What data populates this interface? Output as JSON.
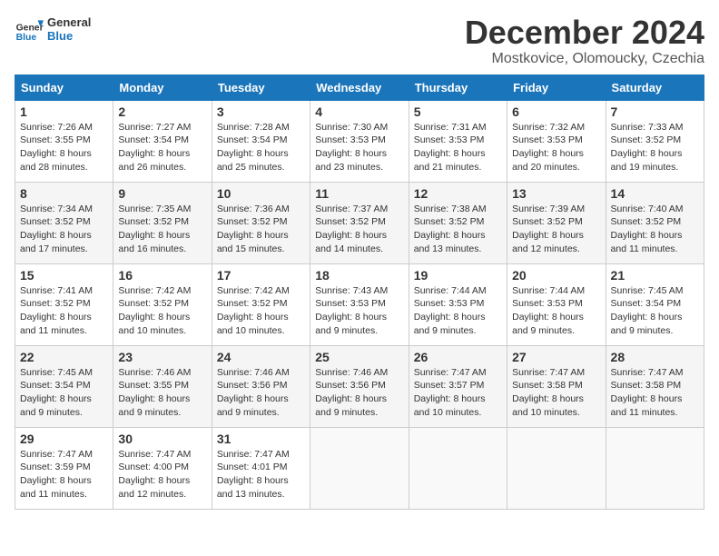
{
  "header": {
    "logo_text_general": "General",
    "logo_text_blue": "Blue",
    "month_title": "December 2024",
    "subtitle": "Mostkovice, Olomoucky, Czechia"
  },
  "days_of_week": [
    "Sunday",
    "Monday",
    "Tuesday",
    "Wednesday",
    "Thursday",
    "Friday",
    "Saturday"
  ],
  "weeks": [
    [
      {
        "day": "1",
        "sunrise": "7:26 AM",
        "sunset": "3:55 PM",
        "daylight": "8 hours and 28 minutes."
      },
      {
        "day": "2",
        "sunrise": "7:27 AM",
        "sunset": "3:54 PM",
        "daylight": "8 hours and 26 minutes."
      },
      {
        "day": "3",
        "sunrise": "7:28 AM",
        "sunset": "3:54 PM",
        "daylight": "8 hours and 25 minutes."
      },
      {
        "day": "4",
        "sunrise": "7:30 AM",
        "sunset": "3:53 PM",
        "daylight": "8 hours and 23 minutes."
      },
      {
        "day": "5",
        "sunrise": "7:31 AM",
        "sunset": "3:53 PM",
        "daylight": "8 hours and 21 minutes."
      },
      {
        "day": "6",
        "sunrise": "7:32 AM",
        "sunset": "3:53 PM",
        "daylight": "8 hours and 20 minutes."
      },
      {
        "day": "7",
        "sunrise": "7:33 AM",
        "sunset": "3:52 PM",
        "daylight": "8 hours and 19 minutes."
      }
    ],
    [
      {
        "day": "8",
        "sunrise": "7:34 AM",
        "sunset": "3:52 PM",
        "daylight": "8 hours and 17 minutes."
      },
      {
        "day": "9",
        "sunrise": "7:35 AM",
        "sunset": "3:52 PM",
        "daylight": "8 hours and 16 minutes."
      },
      {
        "day": "10",
        "sunrise": "7:36 AM",
        "sunset": "3:52 PM",
        "daylight": "8 hours and 15 minutes."
      },
      {
        "day": "11",
        "sunrise": "7:37 AM",
        "sunset": "3:52 PM",
        "daylight": "8 hours and 14 minutes."
      },
      {
        "day": "12",
        "sunrise": "7:38 AM",
        "sunset": "3:52 PM",
        "daylight": "8 hours and 13 minutes."
      },
      {
        "day": "13",
        "sunrise": "7:39 AM",
        "sunset": "3:52 PM",
        "daylight": "8 hours and 12 minutes."
      },
      {
        "day": "14",
        "sunrise": "7:40 AM",
        "sunset": "3:52 PM",
        "daylight": "8 hours and 11 minutes."
      }
    ],
    [
      {
        "day": "15",
        "sunrise": "7:41 AM",
        "sunset": "3:52 PM",
        "daylight": "8 hours and 11 minutes."
      },
      {
        "day": "16",
        "sunrise": "7:42 AM",
        "sunset": "3:52 PM",
        "daylight": "8 hours and 10 minutes."
      },
      {
        "day": "17",
        "sunrise": "7:42 AM",
        "sunset": "3:52 PM",
        "daylight": "8 hours and 10 minutes."
      },
      {
        "day": "18",
        "sunrise": "7:43 AM",
        "sunset": "3:53 PM",
        "daylight": "8 hours and 9 minutes."
      },
      {
        "day": "19",
        "sunrise": "7:44 AM",
        "sunset": "3:53 PM",
        "daylight": "8 hours and 9 minutes."
      },
      {
        "day": "20",
        "sunrise": "7:44 AM",
        "sunset": "3:53 PM",
        "daylight": "8 hours and 9 minutes."
      },
      {
        "day": "21",
        "sunrise": "7:45 AM",
        "sunset": "3:54 PM",
        "daylight": "8 hours and 9 minutes."
      }
    ],
    [
      {
        "day": "22",
        "sunrise": "7:45 AM",
        "sunset": "3:54 PM",
        "daylight": "8 hours and 9 minutes."
      },
      {
        "day": "23",
        "sunrise": "7:46 AM",
        "sunset": "3:55 PM",
        "daylight": "8 hours and 9 minutes."
      },
      {
        "day": "24",
        "sunrise": "7:46 AM",
        "sunset": "3:56 PM",
        "daylight": "8 hours and 9 minutes."
      },
      {
        "day": "25",
        "sunrise": "7:46 AM",
        "sunset": "3:56 PM",
        "daylight": "8 hours and 9 minutes."
      },
      {
        "day": "26",
        "sunrise": "7:47 AM",
        "sunset": "3:57 PM",
        "daylight": "8 hours and 10 minutes."
      },
      {
        "day": "27",
        "sunrise": "7:47 AM",
        "sunset": "3:58 PM",
        "daylight": "8 hours and 10 minutes."
      },
      {
        "day": "28",
        "sunrise": "7:47 AM",
        "sunset": "3:58 PM",
        "daylight": "8 hours and 11 minutes."
      }
    ],
    [
      {
        "day": "29",
        "sunrise": "7:47 AM",
        "sunset": "3:59 PM",
        "daylight": "8 hours and 11 minutes."
      },
      {
        "day": "30",
        "sunrise": "7:47 AM",
        "sunset": "4:00 PM",
        "daylight": "8 hours and 12 minutes."
      },
      {
        "day": "31",
        "sunrise": "7:47 AM",
        "sunset": "4:01 PM",
        "daylight": "8 hours and 13 minutes."
      },
      null,
      null,
      null,
      null
    ]
  ]
}
